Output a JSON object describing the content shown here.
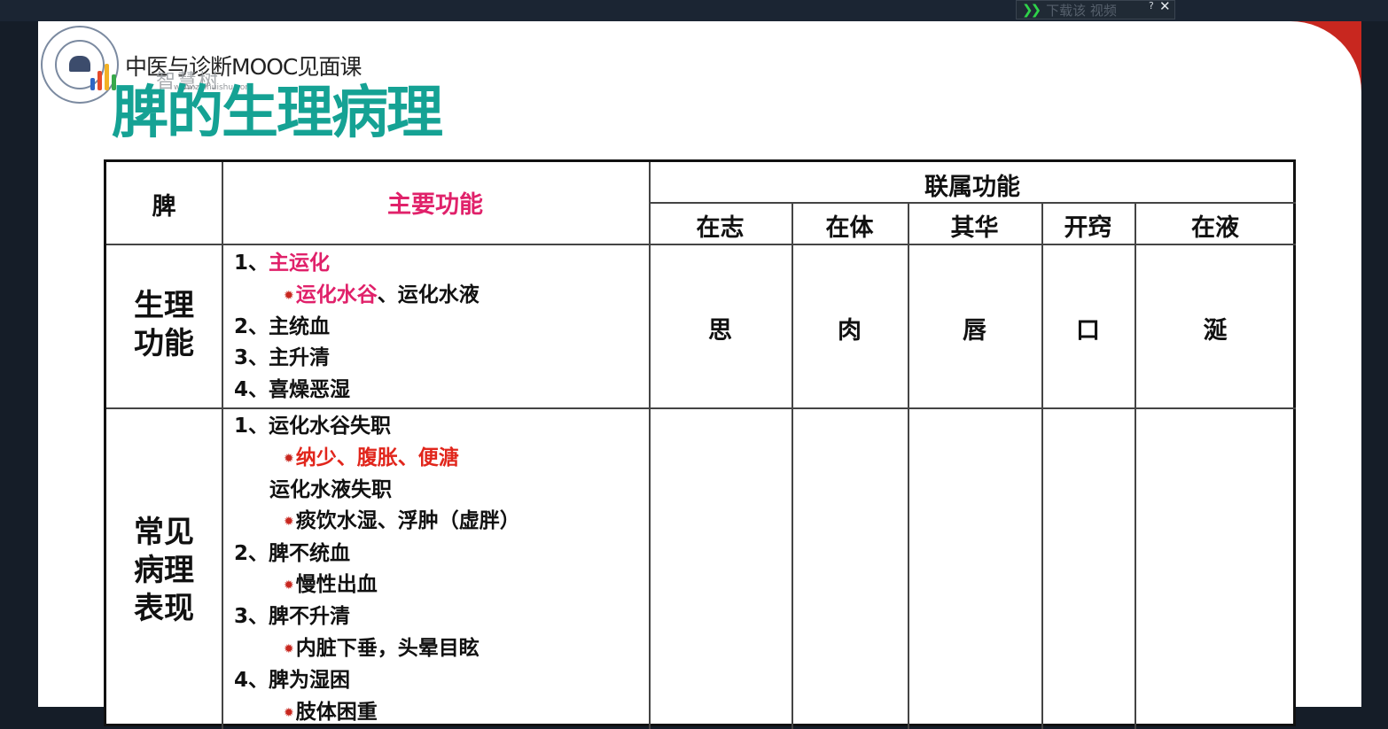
{
  "toolbar": {
    "download_label": "下载该 视频",
    "help_label": "?",
    "close_label": "✕"
  },
  "slide": {
    "course_title": "中医与诊断MOOC见面课",
    "title": "脾的生理病理",
    "watermark": "智慧树",
    "watermark_url": "www.zhihuishu.com"
  },
  "table": {
    "corner_header": "脾",
    "main_header": "主要功能",
    "affiliated_header": "联属功能",
    "sub_headers": [
      "在志",
      "在体",
      "其华",
      "开窍",
      "在液"
    ],
    "rows": [
      {
        "label": "生理功能",
        "label_lines": [
          "生理",
          "功能"
        ],
        "functions": [
          {
            "prefix": "1、",
            "text": "主运化",
            "style": "pink",
            "indent": false
          },
          {
            "bullet": true,
            "text": "运化水谷",
            "style": "pink",
            "suffix": "、运化水液",
            "indent": true
          },
          {
            "prefix": "2、",
            "text": "主统血",
            "style": "normal",
            "indent": false
          },
          {
            "prefix": "3、",
            "text": "主升清",
            "style": "normal",
            "indent": false
          },
          {
            "prefix": "4、",
            "text": "喜燥恶湿",
            "style": "normal",
            "indent": false
          }
        ],
        "values": [
          "思",
          "肉",
          "唇",
          "口",
          "涎"
        ]
      },
      {
        "label": "常见病理表现",
        "label_lines": [
          "常见",
          "病理",
          "表现"
        ],
        "functions": [
          {
            "prefix": "1、",
            "text": "运化水谷失职",
            "style": "normal",
            "indent": false
          },
          {
            "bullet": true,
            "text": "纳少、腹胀、便溏",
            "style": "red",
            "indent": true
          },
          {
            "text": "运化水液失职",
            "style": "normal",
            "indent": "half"
          },
          {
            "bullet": true,
            "text": "痰饮水湿、浮肿（虚胖）",
            "style": "normal",
            "indent": true
          },
          {
            "prefix": "2、",
            "text": "脾不统血",
            "style": "normal",
            "indent": false
          },
          {
            "bullet": true,
            "text": "慢性出血",
            "style": "normal",
            "indent": true
          },
          {
            "prefix": "3、",
            "text": "脾不升清",
            "style": "normal",
            "indent": false
          },
          {
            "bullet": true,
            "text": "内脏下垂，头晕目眩",
            "style": "normal",
            "indent": true
          },
          {
            "prefix": "4、",
            "text": "脾为湿困",
            "style": "normal",
            "indent": false
          },
          {
            "bullet": true,
            "text": "肢体困重",
            "style": "normal",
            "indent": true
          }
        ],
        "values": [
          "",
          "",
          "",
          "",
          ""
        ]
      }
    ]
  },
  "colors": {
    "title": "#15a294",
    "accent_pink": "#e0216a",
    "accent_red": "#e1261c",
    "frame_red": "#c8271f",
    "download_arrow": "#2fd34a"
  },
  "icons": {
    "download": "double-chevron-right-icon",
    "close": "close-icon",
    "help": "question-icon",
    "logo": "university-seal"
  }
}
